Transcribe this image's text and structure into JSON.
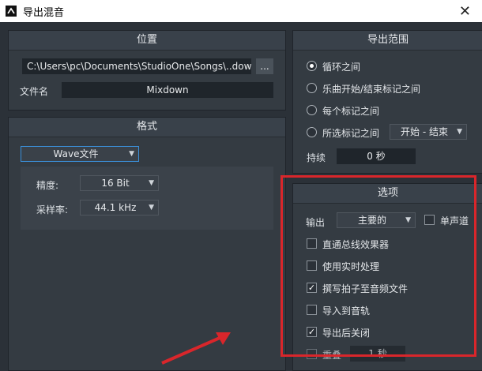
{
  "window": {
    "title": "导出混音",
    "close": "✕"
  },
  "location": {
    "header": "位置",
    "path": "C:\\Users\\pc\\Documents\\StudioOne\\Songs\\..down",
    "browse": "...",
    "filename_label": "文件名",
    "filename": "Mixdown"
  },
  "format": {
    "header": "格式",
    "type": "Wave文件",
    "precision_label": "精度:",
    "precision": "16 Bit",
    "samplerate_label": "采样率:",
    "samplerate": "44.1 kHz"
  },
  "export_range": {
    "header": "导出范围",
    "options": [
      "循环之间",
      "乐曲开始/结束标记之间",
      "每个标记之间",
      "所选标记之间"
    ],
    "selected": 0,
    "marker_select": "开始 - 结束",
    "duration_label": "持续",
    "duration": "0 秒"
  },
  "options": {
    "header": "选项",
    "output_label": "输出",
    "output": "主要的",
    "mono_label": "单声道",
    "mono_checked": false,
    "items": [
      {
        "label": "直通总线效果器",
        "checked": false
      },
      {
        "label": "使用实时处理",
        "checked": false
      },
      {
        "label": "撰写拍子至音频文件",
        "checked": true
      },
      {
        "label": "导入到音轨",
        "checked": false
      },
      {
        "label": "导出后关闭",
        "checked": true
      }
    ],
    "overlap_label": "重叠",
    "overlap": "1 秒"
  },
  "colors": {
    "annotation": "#d9262b",
    "background": "#2b3138"
  }
}
